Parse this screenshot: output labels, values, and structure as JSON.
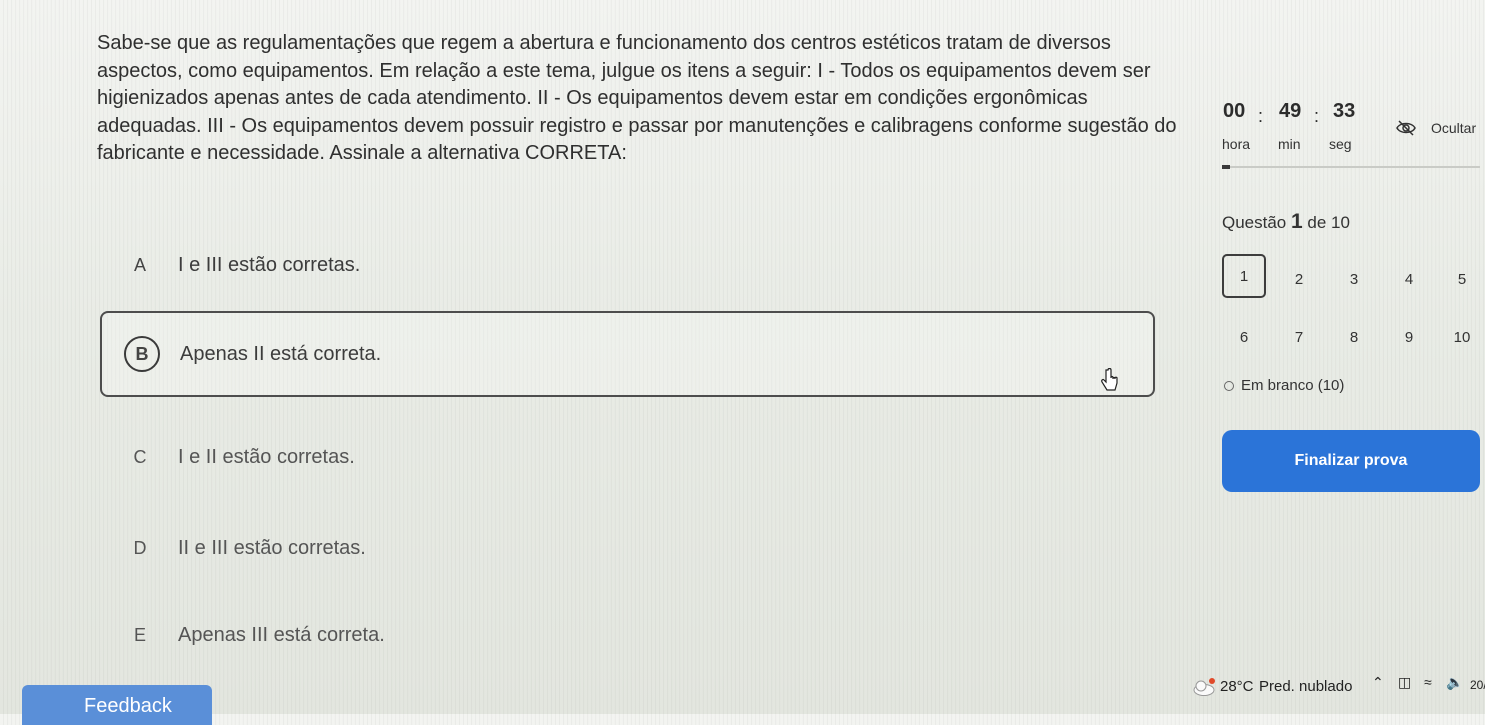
{
  "question": {
    "text": "Sabe-se que as regulamentações que regem a abertura e funcionamento dos centros estéticos tratam de diversos aspectos, como equipamentos. Em relação a este tema, julgue os itens a seguir:   I - Todos os equipamentos devem ser higienizados apenas antes de cada atendimento. II - Os equipamentos devem estar em condições ergonômicas adequadas.   III - Os equipamentos devem possuir registro e passar por manutenções e calibragens conforme sugestão do fabricante e necessidade.    Assinale a alternativa CORRETA:"
  },
  "options": [
    {
      "letter": "A",
      "text": "I e III estão corretas."
    },
    {
      "letter": "B",
      "text": "Apenas II está correta.",
      "selected": true
    },
    {
      "letter": "C",
      "text": "I e II estão corretas."
    },
    {
      "letter": "D",
      "text": "II e III estão corretas."
    },
    {
      "letter": "E",
      "text": "Apenas III está correta."
    }
  ],
  "timer": {
    "hours": "00",
    "minutes": "49",
    "seconds": "33",
    "separator": ":",
    "hours_label": "hora",
    "minutes_label": "min",
    "seconds_label": "seg",
    "hide_label": "Ocultar",
    "elapsed_fraction": 0.03
  },
  "progress": {
    "prefix": "Questão",
    "current": "1",
    "suffix": "de 10"
  },
  "question_nav": [
    "1",
    "2",
    "3",
    "4",
    "5",
    "6",
    "7",
    "8",
    "9",
    "10"
  ],
  "question_nav_current": 1,
  "blank_status": "Em branco (10)",
  "finish_button": "Finalizar prova",
  "feedback_tab": "Feedback",
  "taskbar": {
    "temperature": "28°C",
    "weather": "Pred. nublado",
    "clock_partial": "20/"
  },
  "colors": {
    "primary": "#2b74d8",
    "feedback": "#5a8fd8",
    "text": "#2f2f2f"
  }
}
